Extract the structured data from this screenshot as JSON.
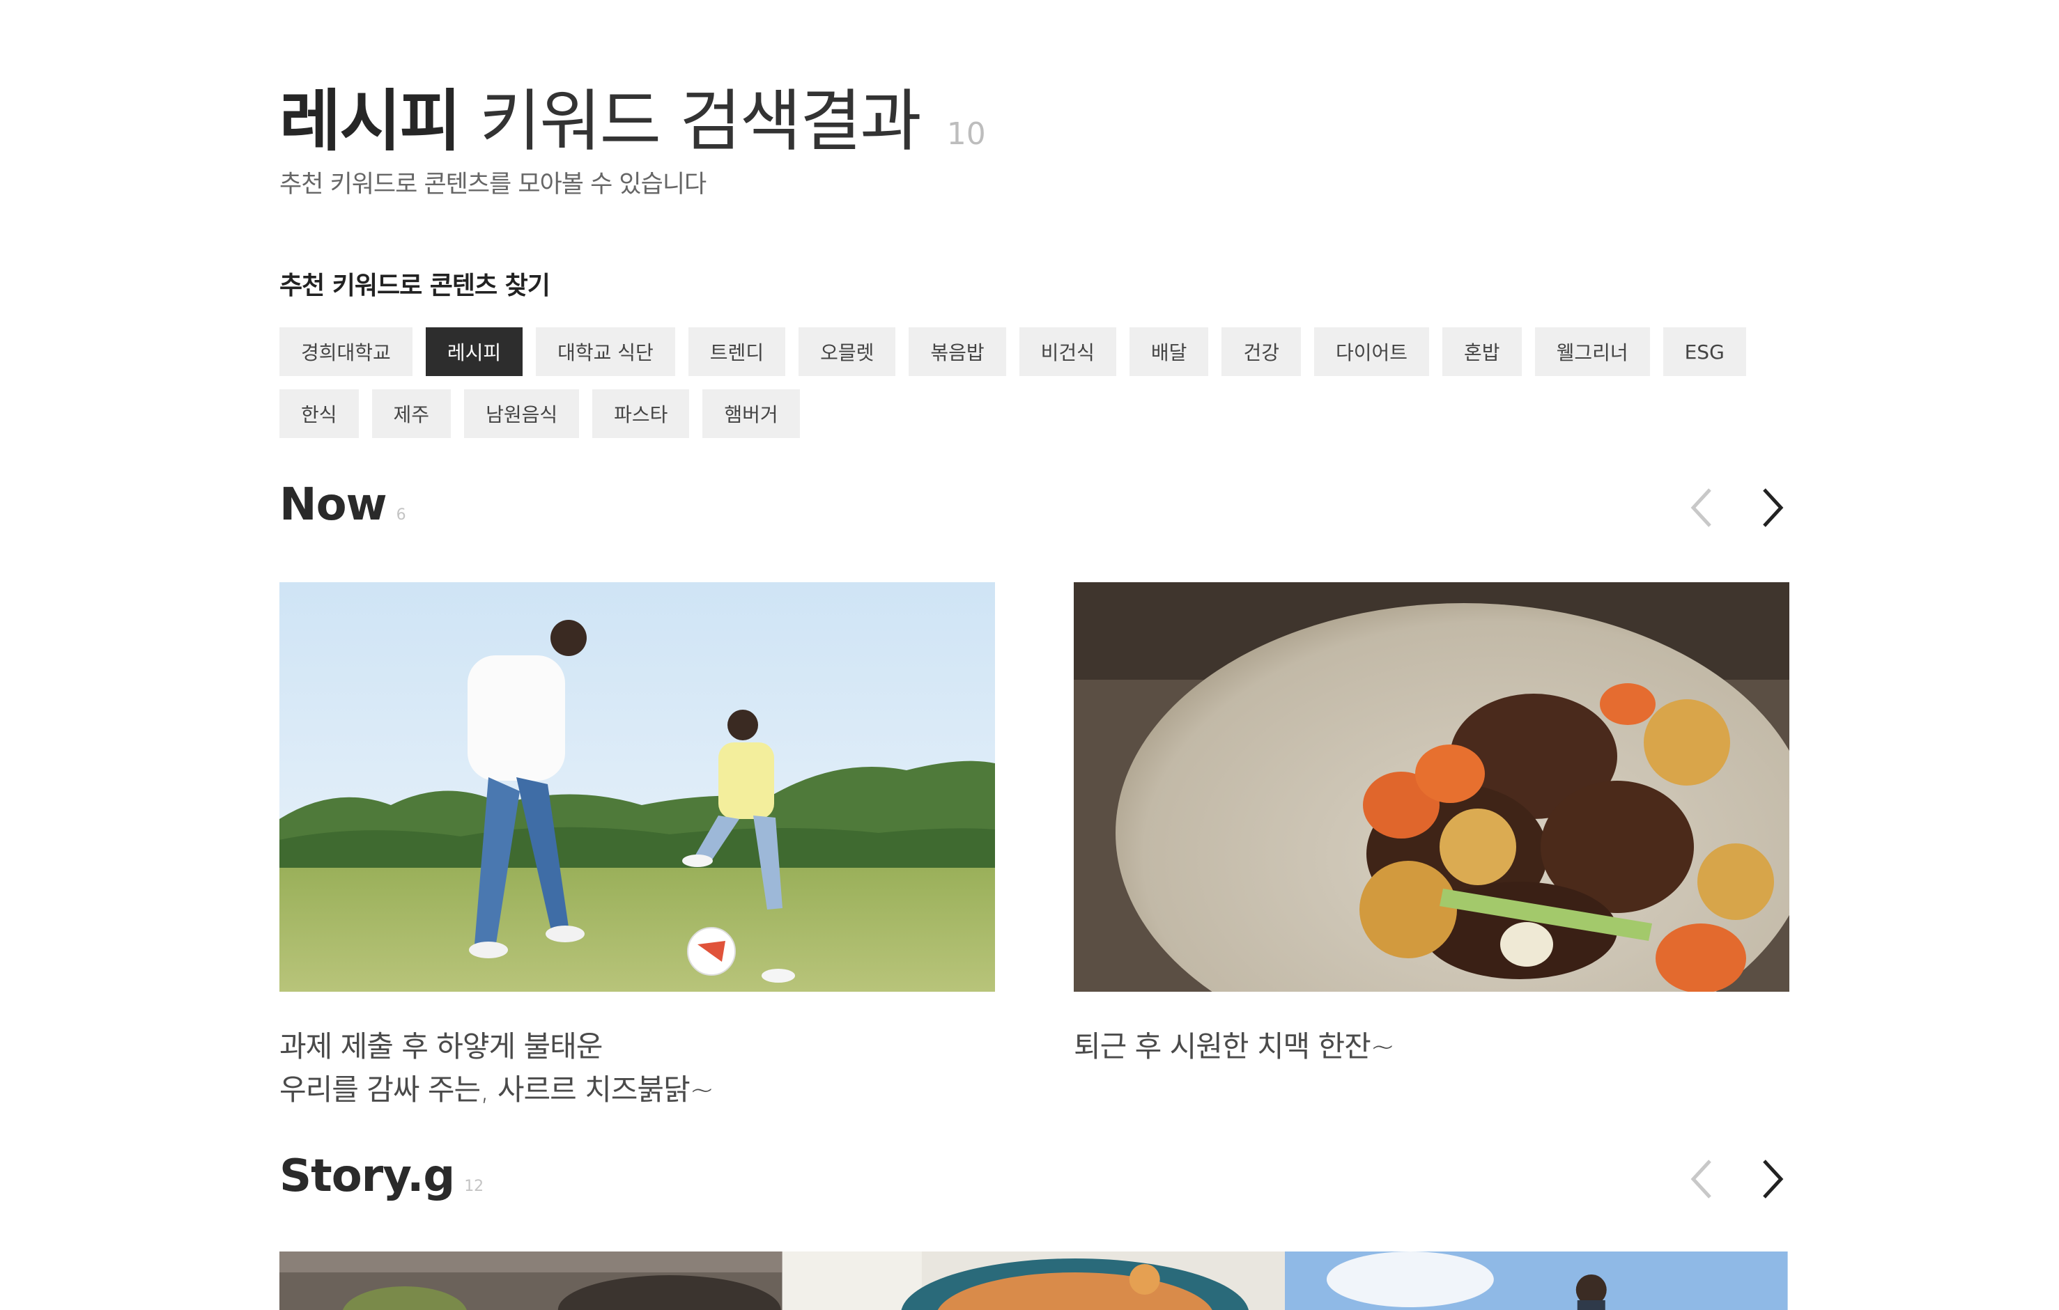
{
  "header": {
    "title_keyword": "레시피",
    "title_rest": "키워드 검색결과",
    "result_count": "10",
    "subtitle": "추천 키워드로 콘텐츠를 모아볼 수 있습니다"
  },
  "keywords": {
    "heading": "추천 키워드로 콘텐츠 찾기",
    "items": [
      "경희대학교",
      "레시피",
      "대학교 식단",
      "트렌디",
      "오믈렛",
      "볶음밥",
      "비건식",
      "배달",
      "건강",
      "다이어트",
      "혼밥",
      "웰그리너",
      "ESG",
      "한식",
      "제주",
      "남원음식",
      "파스타",
      "햄버거"
    ],
    "active": "레시피"
  },
  "now": {
    "title": "Now",
    "count": "6",
    "cards": [
      {
        "line1": "과제 제출 후 하얗게 불태운",
        "line2": "우리를 감싸 주는, 사르르 치즈붉닭~",
        "image": "father-son-soccer-photo"
      },
      {
        "line1": "퇴근 후 시원한 치맥 한잔~",
        "line2": "",
        "image": "braised-short-ribs-photo"
      }
    ]
  },
  "story": {
    "title": "Story.g",
    "count": "12",
    "thumbnails": [
      "food-bowl-photo",
      "seafood-pasta-photo",
      "person-outdoor-photo"
    ]
  },
  "colors": {
    "chip_bg": "#efefef",
    "chip_active_bg": "#2d2d2d",
    "text_dark": "#262626",
    "count_gray": "#bdbdbd"
  }
}
